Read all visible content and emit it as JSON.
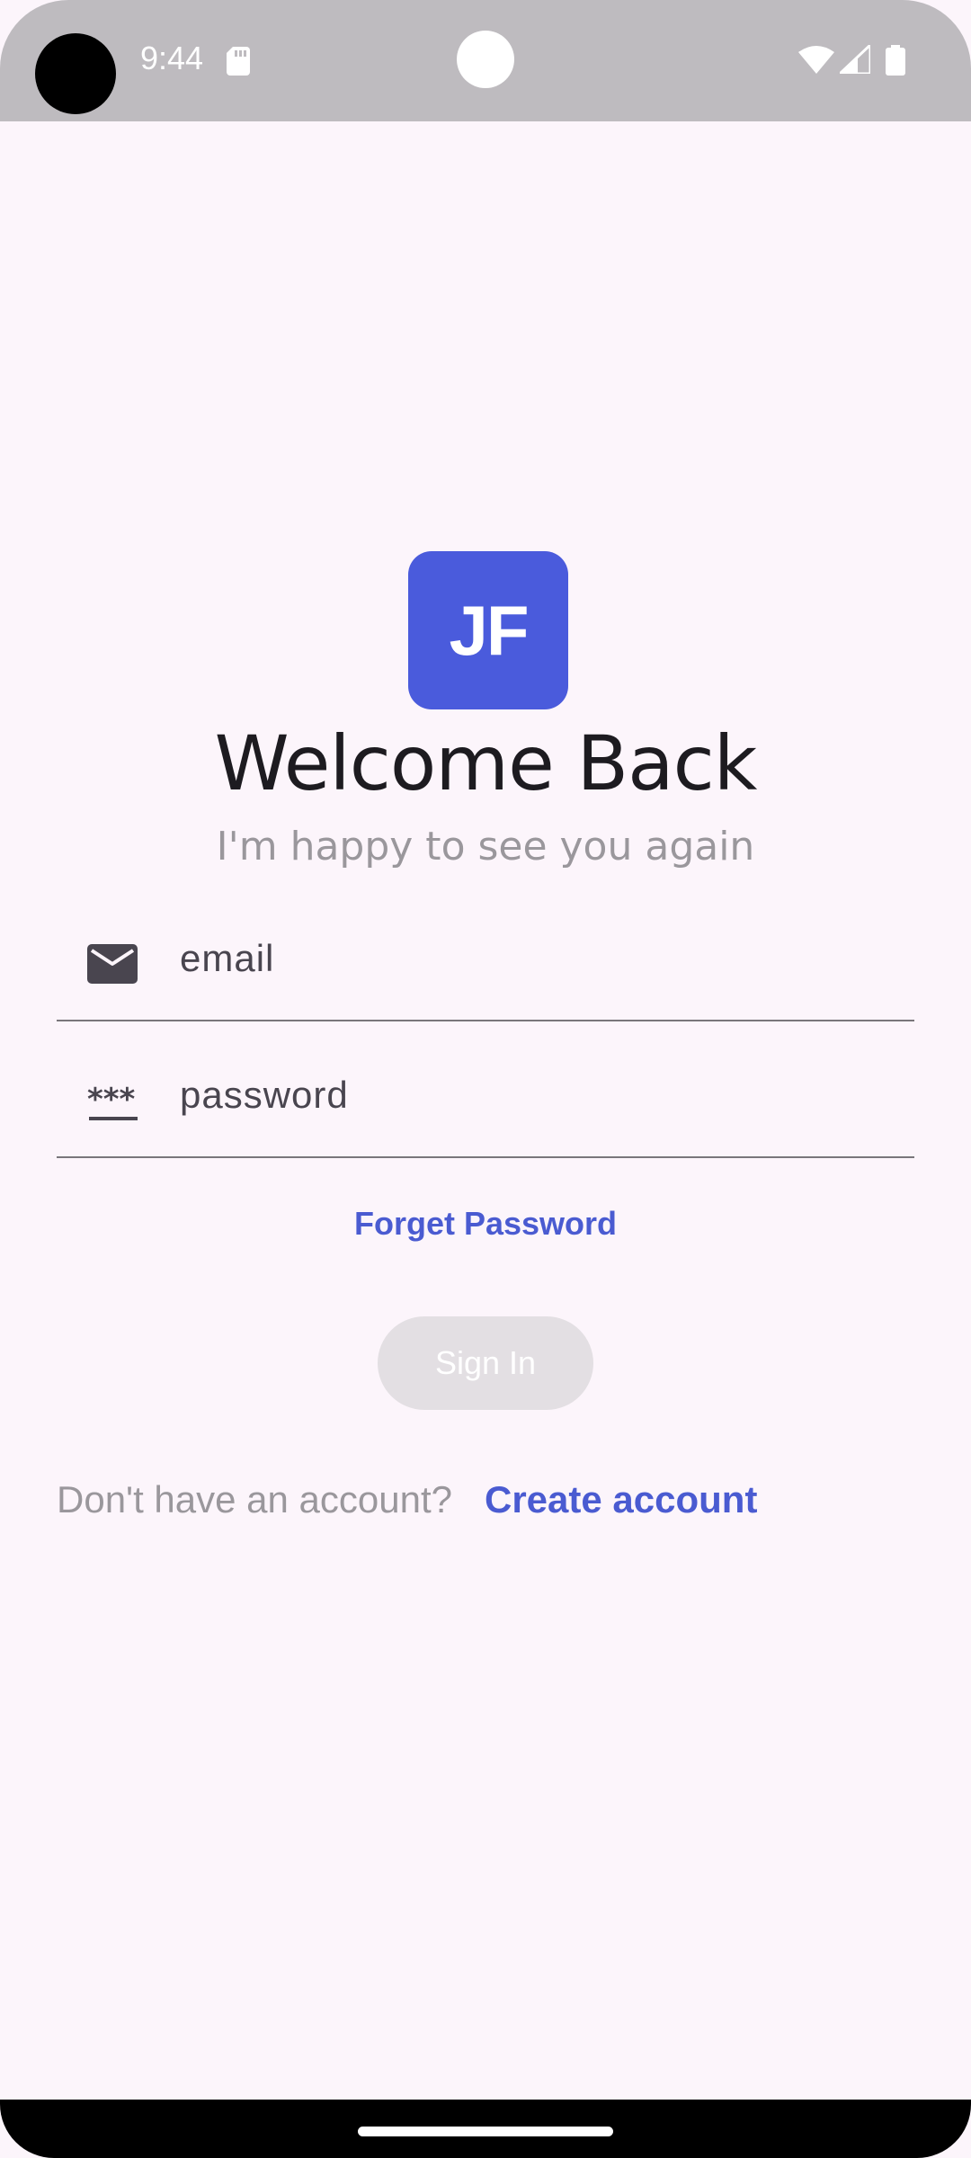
{
  "status_bar": {
    "time": "9:44",
    "icons": [
      "sd-card-icon",
      "wifi-icon",
      "signal-icon",
      "battery-icon"
    ]
  },
  "app": {
    "logo_text": "JF",
    "title": "Welcome Back",
    "subtitle": "I'm happy to see you again"
  },
  "form": {
    "email_placeholder": "email",
    "email_icon": "mail-icon",
    "password_placeholder": "password",
    "password_icon": "password-icon",
    "forgot_label": "Forget Password",
    "signin_label": "Sign In",
    "no_account_text": "Don't have an account?",
    "create_account_label": "Create account"
  },
  "colors": {
    "background": "#fcf5fb",
    "accent": "#4a5bdc",
    "link": "#4a5bd1",
    "status_bar": "#bebbbf",
    "button_disabled": "#e3dfe3"
  }
}
